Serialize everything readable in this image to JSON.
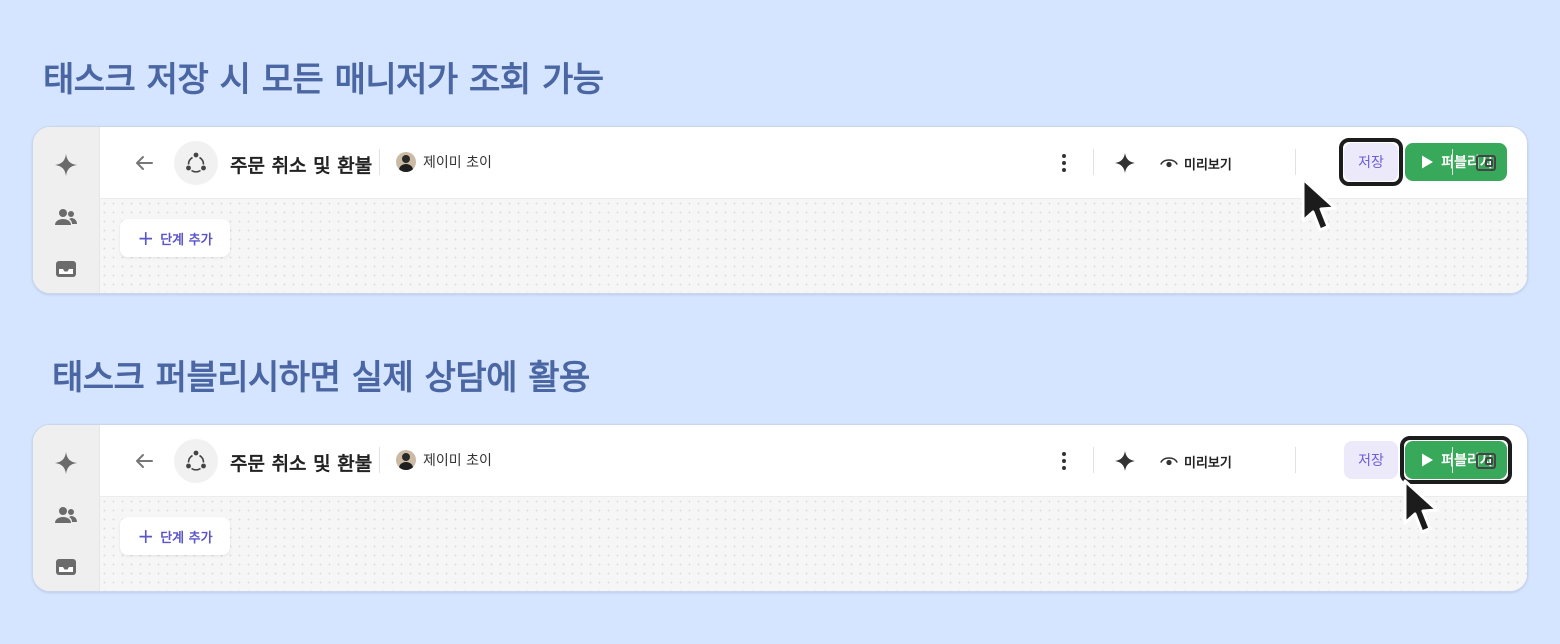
{
  "headings": {
    "save": "태스크 저장 시 모든 매니저가 조회 가능",
    "publish": "태스크 퍼블리시하면 실제 상담에 활용"
  },
  "task": {
    "title": "주문 취소 및 환불",
    "owner": "제이미 초이"
  },
  "toolbar": {
    "preview_label": "미리보기",
    "save_label": "저장",
    "publish_label": "퍼블리시"
  },
  "canvas": {
    "add_step_label": "단계 추가"
  },
  "sidebar": {
    "icons": [
      "sparkle-icon",
      "users-icon",
      "inbox-icon"
    ]
  },
  "colors": {
    "background": "#d6e5ff",
    "heading": "#4a66a3",
    "publish": "#38a85a",
    "save_bg": "#ece9fb",
    "accent": "#5b55c9"
  },
  "highlight": [
    "save",
    "publish"
  ]
}
